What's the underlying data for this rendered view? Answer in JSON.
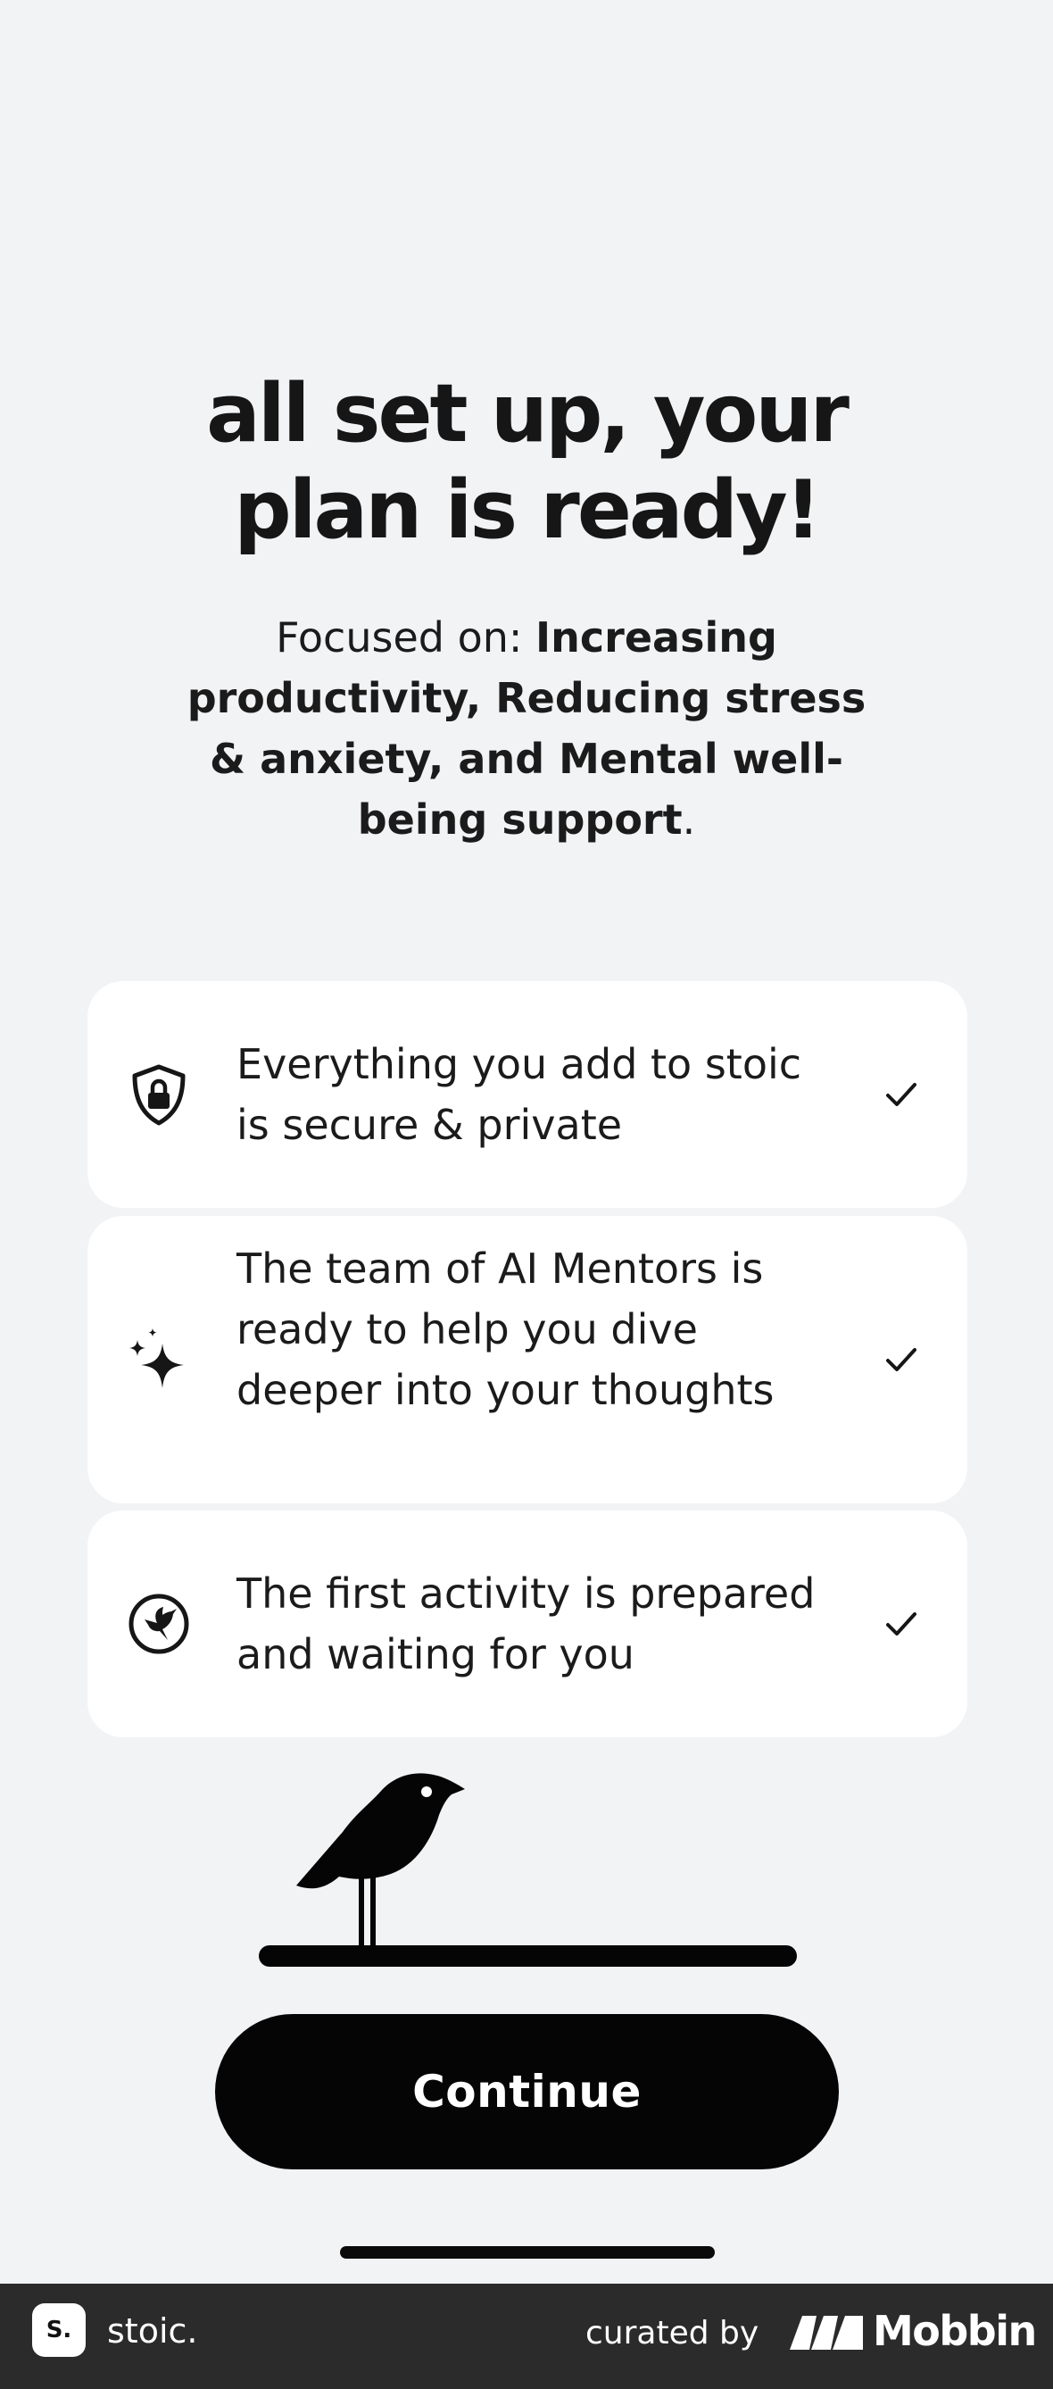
{
  "header": {
    "title_line1": "all set up, your",
    "title_line2": "plan is ready!"
  },
  "focus": {
    "prefix": "Focused on: ",
    "topics": "Increasing productivity, Reducing stress & anxiety, and Mental well-being support",
    "suffix": "."
  },
  "cards": [
    {
      "icon": "shield-lock-icon",
      "text": "Everything you add to stoic is secure & private",
      "status": "check-icon"
    },
    {
      "icon": "sparkles-icon",
      "text": "The team of AI Mentors is ready to help you dive deeper into your thoughts",
      "status": "check-icon"
    },
    {
      "icon": "hummingbird-icon",
      "text": "The first activity is prepared and waiting for you",
      "status": "check-icon"
    }
  ],
  "illustration": "bird-on-branch",
  "actions": {
    "continue_label": "Continue"
  },
  "footer": {
    "app_badge": "S.",
    "app_name": "stoic.",
    "curated_by": "curated by",
    "brand": "Mobbin"
  },
  "colors": {
    "background": "#f2f3f5",
    "card": "#ffffff",
    "button": "#050505",
    "button_text": "#ffffff",
    "footer": "#2b2b2b"
  }
}
